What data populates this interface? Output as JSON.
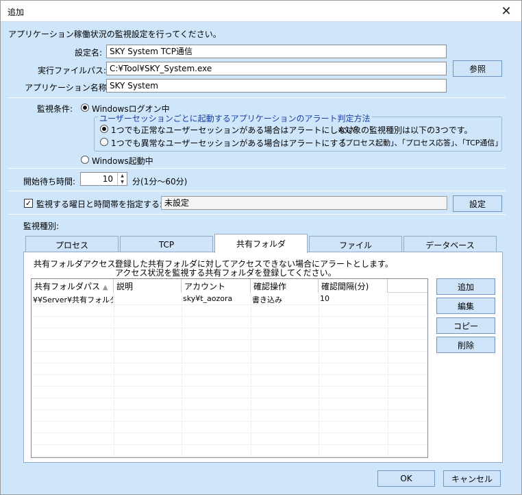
{
  "window": {
    "title": "追加",
    "close_glyph": "✕"
  },
  "intro": "アプリケーション稼働状況の監視設定を行ってください。",
  "fields": {
    "setting_name_label": "設定名:",
    "setting_name_value": "SKY System TCP通信",
    "exe_path_label": "実行ファイルパス:",
    "exe_path_value": "C:¥Tool¥SKY_System.exe",
    "app_name_label": "アプリケーション名称:",
    "app_name_value": "SKY System",
    "browse_button": "参照"
  },
  "condition": {
    "label": "監視条件:",
    "option_logon": "Windowsログオン中",
    "group_title": "ユーザーセッションごとに起動するアプリケーションのアラート判定方法",
    "option_normal": "1つでも正常なユーザーセッションがある場合はアラートにしない",
    "option_abnormal": "1つでも異常なユーザーセッションがある場合はアラートにする",
    "note_line1": "※対象の監視種別は以下の3つです。",
    "note_line2": "「プロセス起動」、「プロセス応答」、「TCP通信」",
    "option_startup": "Windows起動中",
    "selected": "logon",
    "sub_selected": "normal"
  },
  "wait": {
    "label": "開始待ち時間:",
    "value": "10",
    "unit": "分(1分〜60分)"
  },
  "schedule": {
    "checkbox_label": "監視する曜日と時間帯を指定する:",
    "checked": true,
    "value": "未設定",
    "button": "設定"
  },
  "monitor_type_label": "監視種別:",
  "tabs": [
    "プロセス",
    "TCP",
    "共有フォルダ",
    "ファイル",
    "データベース"
  ],
  "active_tab": 2,
  "panel": {
    "desc_label": "共有フォルダアクセス:",
    "desc_line1": "登録した共有フォルダに対してアクセスできない場合にアラートとします。",
    "desc_line2": "アクセス状況を監視する共有フォルダを登録してください。",
    "columns": [
      "共有フォルダパス",
      "説明",
      "アカウント",
      "確認操作",
      "確認間隔(分)"
    ],
    "sort_glyph": "▲",
    "rows": [
      [
        "¥¥Server¥共有フォルダ",
        "",
        "sky¥t_aozora",
        "書き込み",
        "10"
      ]
    ],
    "buttons": {
      "add": "追加",
      "edit": "編集",
      "copy": "コピー",
      "delete": "削除"
    }
  },
  "footer": {
    "ok": "OK",
    "cancel": "キャンセル"
  }
}
